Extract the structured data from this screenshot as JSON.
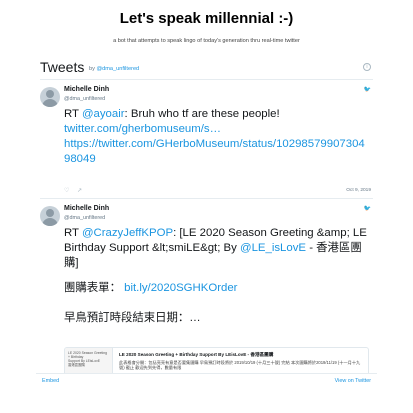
{
  "page": {
    "title": "Let's speak millennial :-)",
    "subtitle": "a bot that attempts to speak lingo of today's generation thru real-time twitter"
  },
  "timeline": {
    "title": "Tweets",
    "by_prefix": "by",
    "by_handle": "@dma_unfiltered",
    "info_glyph": "i",
    "footer": {
      "embed": "Embed",
      "view": "View on Twitter"
    }
  },
  "tweets": [
    {
      "author_name": "Michelle Dinh",
      "author_handle": "@dma_unfiltered",
      "brand_glyph": "🐦",
      "rt_prefix": "RT ",
      "mention": "@ayoair",
      "text_after_mention": ": Bruh who tf are these people!",
      "link1": "twitter.com/gherbomuseum/s…",
      "link2": "https://twitter.com/GHerboMuseum/status/1029857990730498049",
      "date": "Oct 9, 2019",
      "actions": {
        "reply": "♡",
        "share": "↗"
      }
    },
    {
      "author_name": "Michelle Dinh",
      "author_handle": "@dma_unfiltered",
      "brand_glyph": "🐦",
      "rt_prefix": "RT ",
      "mention": "@CrazyJeffKPOP",
      "text_mid": ": [LE 2020 Season Greeting &amp; LE Birthday Support &lt;smiLE&gt; By ",
      "mention2": "@LE_isLovE",
      "text_end": " - 香港區團購]",
      "para2_label": "團購表單：",
      "para2_link": "bit.ly/2020SGHKOrder",
      "para3": "早鳥預訂時段結束日期：…",
      "card": {
        "thumb_lines": [
          "LE 2020 Season Greeting + Birthday",
          "Support By LEisLovE",
          "香港區團購"
        ],
        "title": "LE 2020 Season Greeting + Birthday Support By LEisLovE - 香港區團購",
        "description": "此表格會分開：包括亮亮有意是否要集團購 早鳥預訂時段將於 2019/10/19 (十月三十號) 完結 本次團購將於2019/11/19 (十一月十九號) 截止 歡迎先到先得，數量有限"
      }
    }
  ]
}
